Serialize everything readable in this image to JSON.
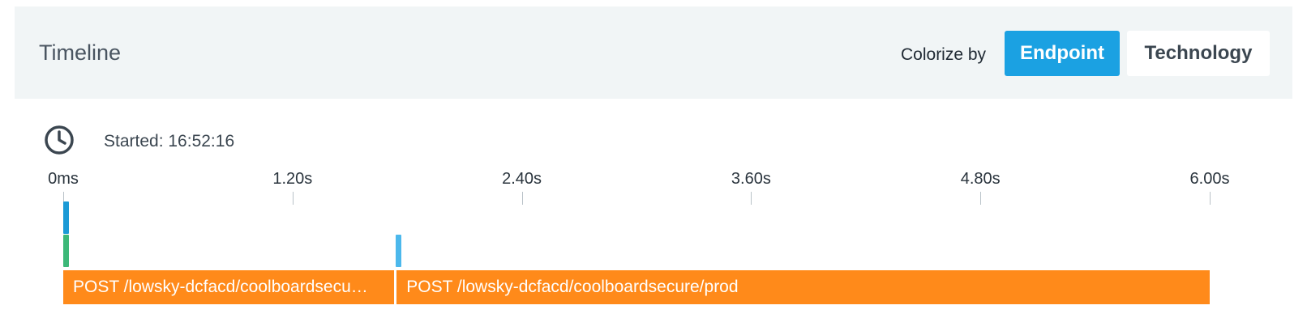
{
  "header": {
    "title": "Timeline",
    "colorize_label": "Colorize by",
    "buttons": [
      {
        "label": "Endpoint",
        "active": true
      },
      {
        "label": "Technology",
        "active": false
      }
    ]
  },
  "started": {
    "icon": "clock-icon",
    "text": "Started: 16:52:16"
  },
  "axis": {
    "ticks": [
      "0ms",
      "1.20s",
      "2.40s",
      "3.60s",
      "4.80s",
      "6.00s"
    ],
    "max_seconds": 6.0
  },
  "spans": [
    {
      "label": "",
      "start_s": 0.0,
      "end_s": 0.03,
      "row": 0,
      "color": "#1b9ad6"
    },
    {
      "label": "",
      "start_s": 0.0,
      "end_s": 0.03,
      "row": 1,
      "color": "#3cb878"
    },
    {
      "label": "",
      "start_s": 1.74,
      "end_s": 1.77,
      "row": 1,
      "color": "#4cb8ec"
    },
    {
      "label": "POST /lowsky-dcfacd/coolboardsecure/prod",
      "display": "POST /lowsky-dcfacd/coolboardsecu…",
      "start_s": 0.0,
      "end_s": 1.73,
      "row": 2,
      "color": "#ff8a1a"
    },
    {
      "label": "POST /lowsky-dcfacd/coolboardsecure/prod",
      "display": "POST /lowsky-dcfacd/coolboardsecure/prod",
      "start_s": 1.745,
      "end_s": 6.0,
      "row": 2,
      "color": "#ff8a1a"
    }
  ],
  "colors": {
    "accent": "#1ba1e2",
    "span_orange": "#ff8a1a",
    "header_bg": "#f1f5f6"
  }
}
